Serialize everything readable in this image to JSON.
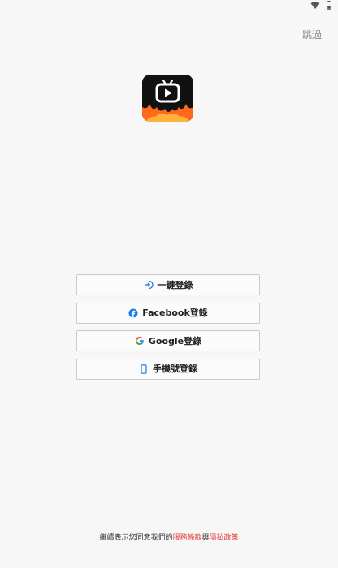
{
  "header": {
    "skip_label": "跳過"
  },
  "login_options": [
    {
      "label": "一鍵登錄",
      "icon": "login-arrow-icon"
    },
    {
      "label": "Facebook登錄",
      "icon": "facebook-icon"
    },
    {
      "label": "Google登錄",
      "icon": "google-icon"
    },
    {
      "label": "手機號登錄",
      "icon": "phone-icon"
    }
  ],
  "agreement": {
    "prefix": "繼續表示您同意我們的",
    "terms": "服務條款",
    "connector": "與",
    "privacy": "隱私政策"
  },
  "colors": {
    "accent": "#e53935",
    "facebook": "#1877f2",
    "flame": "#ff6a1a"
  }
}
